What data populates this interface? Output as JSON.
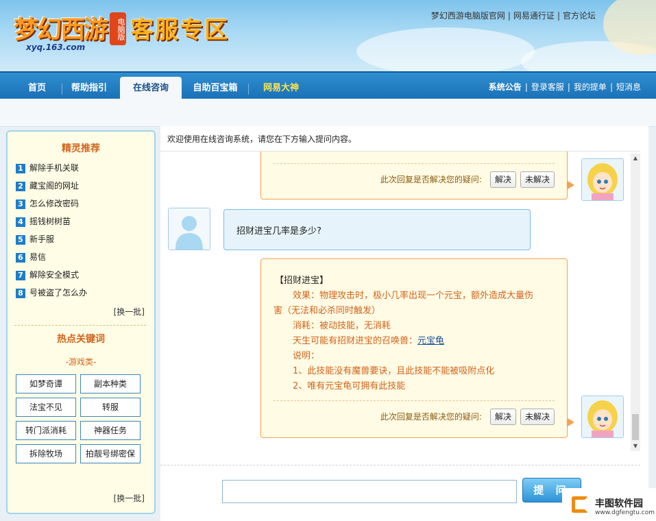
{
  "header": {
    "logo_text": "梦幻西游",
    "logo_badge": "电脑版",
    "logo_url": "xyq.163.com",
    "site_title": "客服专区",
    "top_links": [
      "梦幻西游电脑版官网",
      "网易通行证",
      "官方论坛"
    ]
  },
  "nav": {
    "tabs": [
      {
        "label": "首页"
      },
      {
        "label": "帮助指引"
      },
      {
        "label": "在线咨询"
      },
      {
        "label": "自助百宝箱"
      },
      {
        "label": "网易大神"
      }
    ],
    "active_tab": "在线咨询",
    "right_links": [
      "系统公告",
      "登录客服",
      "我的提单",
      "短消息"
    ]
  },
  "sidebar": {
    "recommend_title": "精灵推荐",
    "items": [
      {
        "num": "1",
        "label": "解除手机关联"
      },
      {
        "num": "2",
        "label": "藏宝阁的网址"
      },
      {
        "num": "3",
        "label": "怎么修改密码"
      },
      {
        "num": "4",
        "label": "摇钱树树苗"
      },
      {
        "num": "5",
        "label": "新手服"
      },
      {
        "num": "6",
        "label": "易信"
      },
      {
        "num": "7",
        "label": "解除安全模式"
      },
      {
        "num": "8",
        "label": "号被盗了怎么办"
      }
    ],
    "refresh_label": "[换一批]",
    "hot_title": "热点关键词",
    "category": "-游戏类-",
    "keywords": [
      "如梦奇谭",
      "副本种类",
      "法宝不见",
      "转服",
      "转门派消耗",
      "神器任务",
      "拆除牧场",
      "拍靓号绑密保"
    ]
  },
  "chat": {
    "welcome": "欢迎使用在线咨询系统，请您在下方输入提问内容。",
    "resolve_question": "此次回复是否解决您的疑问:",
    "resolved_label": "解决",
    "unresolved_label": "未解决",
    "user_question": "招财进宝几率是多少?",
    "answer": {
      "title": "【招财进宝】",
      "effect": "效果：物理攻击时，极小几率出现一个元宝，额外造成大量伤",
      "effect_cont": "害（无法和必杀同时触发）",
      "cost": "消耗：被动技能，无消耗",
      "pet_prefix": "天生可能有招财进宝的召唤兽：",
      "pet_link": "元宝龟",
      "note_title": "说明：",
      "note1": "1、此技能没有魔兽要诀，且此技能不能被吸附点化",
      "note2": "2、唯有元宝龟可拥有此技能"
    }
  },
  "composer": {
    "input_value": "",
    "submit_label": "提 问"
  },
  "watermark": {
    "name": "丰图软件园",
    "url": "www.dgfengtu.com"
  }
}
